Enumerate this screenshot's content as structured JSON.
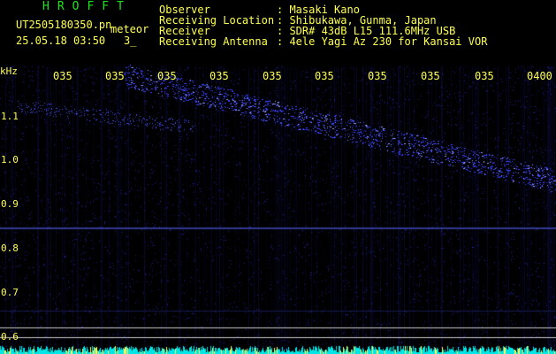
{
  "app": {
    "logo": "HROFFT",
    "filename": "UT2505180350.pn",
    "meteor_label": "meteor",
    "datetime": "25.05.18 03:50",
    "count": "3_"
  },
  "info": [
    {
      "label": "Observer",
      "value": ": Masaki Kano"
    },
    {
      "label": "Receiving Location",
      "value": ": Shibukawa, Gunma, Japan"
    },
    {
      "label": "Receiver",
      "value": ": SDR# 43dB L15 111.6MHz USB"
    },
    {
      "label": "Receiving Antenna",
      "value": ": 4ele Yagi Az 230 for Kansai VOR"
    }
  ],
  "axis": {
    "unit": "kHz",
    "y_ticks": [
      "1.1",
      "1.0",
      "0.9",
      "0.8",
      "0.7",
      "0.6"
    ],
    "x_ticks": [
      "035",
      "035",
      "035",
      "035",
      "035",
      "035",
      "035",
      "035",
      "035",
      "0400"
    ]
  },
  "colors": {
    "background": "#000000",
    "text": "#ffff52",
    "logo": "#19e619",
    "signal": "#3c46ff",
    "baseline": "#00e6e6"
  }
}
